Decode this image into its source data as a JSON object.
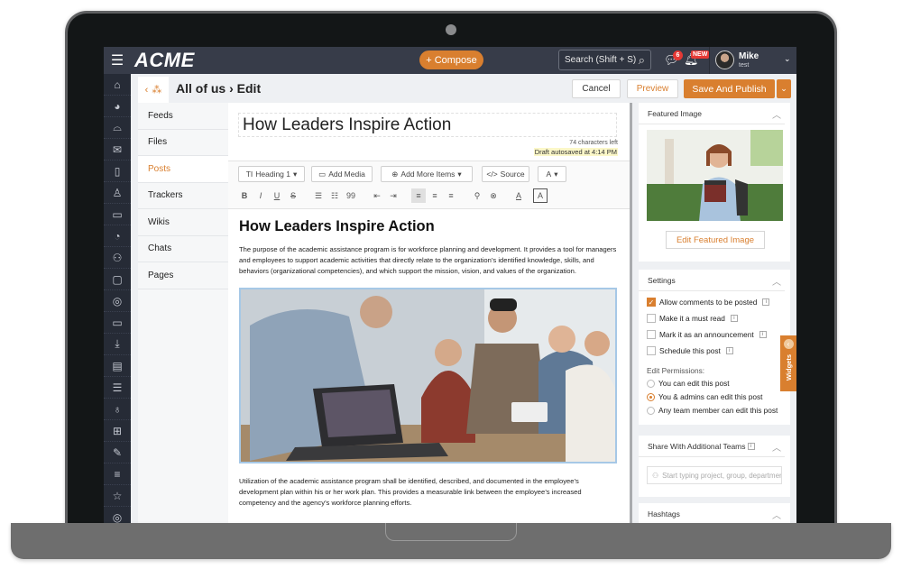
{
  "app": {
    "logo": "ACME",
    "compose_label": "+ Compose",
    "search_placeholder": "Search (Shift + S)",
    "notifications": {
      "chat_count": "6",
      "bell_badge": "NEW"
    },
    "user": {
      "name": "Mike",
      "subtitle": "test"
    }
  },
  "rail": {
    "icons": [
      "home-icon",
      "globe-icon",
      "inbox-icon",
      "mail-icon",
      "file-icon",
      "user-icon",
      "briefcase-icon",
      "pie-chart-icon",
      "group-icon",
      "calendar-icon",
      "target-icon",
      "video-icon",
      "download-icon",
      "document-icon",
      "checklist-icon",
      "lightbulb-icon",
      "table-icon",
      "pencil-icon",
      "list-icon",
      "star-icon",
      "settings-icon"
    ],
    "glyphs": [
      "⌂",
      "◕",
      "⌓",
      "✉",
      "▯",
      "♙",
      "▭",
      "◔",
      "⚇",
      "▢",
      "◎",
      "▭",
      "⤓",
      "▤",
      "☰",
      "♁",
      "⊞",
      "✎",
      "≡",
      "☆",
      "◎"
    ]
  },
  "breadcrumb": {
    "back": "‹",
    "group_icon": "⁂",
    "text": "All of us › Edit"
  },
  "actions": {
    "cancel": "Cancel",
    "preview": "Preview",
    "publish": "Save And Publish",
    "publish_caret": "⌄"
  },
  "subnav": {
    "items": [
      {
        "label": "Feeds",
        "active": false
      },
      {
        "label": "Files",
        "active": false
      },
      {
        "label": "Posts",
        "active": true
      },
      {
        "label": "Trackers",
        "active": false
      },
      {
        "label": "Wikis",
        "active": false
      },
      {
        "label": "Chats",
        "active": false
      },
      {
        "label": "Pages",
        "active": false
      }
    ]
  },
  "editor": {
    "title": "How Leaders Inspire Action",
    "chars_left": "74 characters left",
    "autosave": "Draft autosaved at 4:14 PM",
    "toolbar": {
      "heading": "Heading 1",
      "add_media": "Add Media",
      "add_more": "Add More Items",
      "source": "Source",
      "font": "A"
    },
    "format_icons": [
      "B",
      "I",
      "U",
      "S",
      "☰",
      "☷",
      "99",
      "⇤",
      "⇥",
      "≡",
      "≡",
      "≡",
      "⚲",
      "⊗",
      "A",
      "A"
    ],
    "heading": "How Leaders Inspire Action",
    "paragraph1": "The purpose of the academic assistance program is for workforce planning and development. It provides a tool for managers and employees to support academic activities that directly relate to the organization’s identified knowledge, skills, and behaviors (organizational competencies), and which support the mission, vision, and values of the organization.",
    "paragraph2": "Utilization of the academic assistance program shall be identified, described, and documented in the employee’s development plan within his or her work plan. This provides a measurable link between the employee’s increased competency and the agency’s workforce planning efforts."
  },
  "featured_image": {
    "title": "Featured Image",
    "edit_label": "Edit Featured Image"
  },
  "settings": {
    "title": "Settings",
    "checkboxes": [
      {
        "label": "Allow comments to be posted",
        "checked": true
      },
      {
        "label": "Make it a must read",
        "checked": false
      },
      {
        "label": "Mark it as an announcement",
        "checked": false
      },
      {
        "label": "Schedule this post",
        "checked": false
      }
    ],
    "permissions_label": "Edit Permissions:",
    "permissions": [
      {
        "label": "You can edit this post",
        "checked": false
      },
      {
        "label": "You & admins can edit this post",
        "checked": true
      },
      {
        "label": "Any team member can edit this post",
        "checked": false
      }
    ]
  },
  "share": {
    "title": "Share With Additional Teams",
    "placeholder": "Start typing project, group, department"
  },
  "hashtags": {
    "title": "Hashtags"
  },
  "widgets_tab": {
    "label": "Widgets"
  },
  "colors": {
    "accent": "#d97f2f",
    "topbar": "#373c49",
    "rail": "#262b36"
  }
}
